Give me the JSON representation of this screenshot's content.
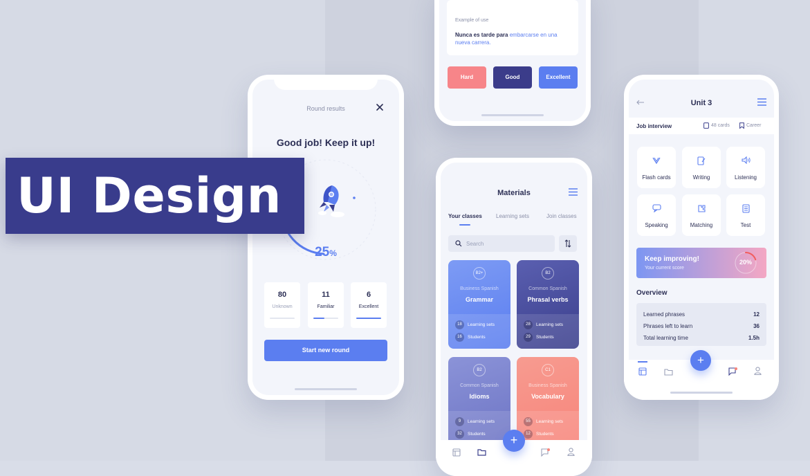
{
  "banner": {
    "title": "UI Design"
  },
  "colors": {
    "primary": "#5b7ef0",
    "navy": "#3b3f8c",
    "hard": "#f78589",
    "good": "#3b3c8a",
    "coral": "#f7857b",
    "bg": "#d9dde8"
  },
  "round_results": {
    "header": "Round results",
    "close_icon": "close-icon",
    "headline": "Good job! Keep it up!",
    "progress_value": "25",
    "progress_unit": "%",
    "progress_fraction": 0.25,
    "stats": [
      {
        "value": "80",
        "label": "Unknown",
        "fill": 0.0
      },
      {
        "value": "11",
        "label": "Familiar",
        "fill": 0.45
      },
      {
        "value": "6",
        "label": "Excellent",
        "fill": 1.0
      }
    ],
    "start_button": "Start new round"
  },
  "example_card": {
    "label": "Example of use",
    "sentence_plain": "Nunca es tarde para ",
    "sentence_highlight_1": "embarcarse en una",
    "sentence_highlight_2": "nueva carrera",
    "sentence_end": ".",
    "buttons": [
      "Hard",
      "Good",
      "Excellent"
    ]
  },
  "materials": {
    "title": "Materials",
    "tabs": [
      "Your classes",
      "Learning sets",
      "Join classes"
    ],
    "search_placeholder": "Search",
    "cards": [
      {
        "level": "B2+",
        "category": "Business Spanish",
        "name": "Grammar",
        "sets": "18",
        "sets_label": "Learning sets",
        "students": "16",
        "students_label": "Students"
      },
      {
        "level": "B2",
        "category": "Common Spanish",
        "name": "Phrasal verbs",
        "sets": "28",
        "sets_label": "Learning sets",
        "students": "29",
        "students_label": "Students"
      },
      {
        "level": "B2",
        "category": "Common Spanish",
        "name": "Idioms",
        "sets": "9",
        "sets_label": "Learning sets",
        "students": "32",
        "students_label": "Students"
      },
      {
        "level": "C1",
        "category": "Business Spanish",
        "name": "Vocabulary",
        "sets": "55",
        "sets_label": "Learning sets",
        "students": "12",
        "students_label": "Students"
      }
    ],
    "fab": "+"
  },
  "unit": {
    "title": "Unit 3",
    "topic": "Job interview",
    "cards_count": "48 cards",
    "career": "Career",
    "tiles": [
      "Flash cards",
      "Writing",
      "Listening",
      "Speaking",
      "Matching",
      "Test"
    ],
    "score_title": "Keep improving!",
    "score_sub": "Your current score",
    "score_value": "20%",
    "overview_title": "Overview",
    "overview": [
      {
        "label": "Learned phrases",
        "value": "12"
      },
      {
        "label": "Phrases left to learn",
        "value": "36"
      },
      {
        "label": "Total learning time",
        "value": "1.5h"
      }
    ],
    "fab": "+"
  }
}
